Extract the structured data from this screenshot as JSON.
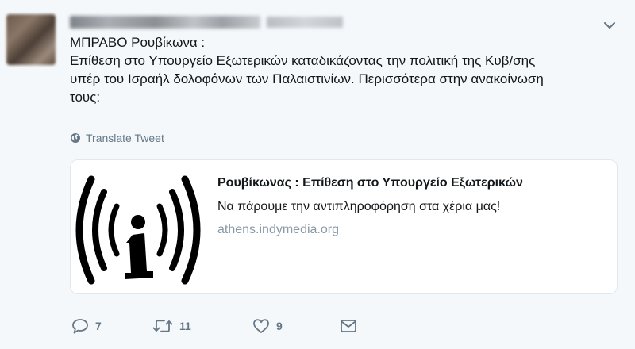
{
  "tweet": {
    "line1": "ΜΠΡΑΒΟ Ρουβίκωνα :",
    "line2": "Επίθεση στο Υπουργείο Εξωτερικών καταδικάζοντας την πολιτική της Κυβ/σης",
    "line3": "υπέρ του Ισραήλ δολοφόνων των Παλαιστινίων. Περισσότερα στην ανακοίνωση",
    "line4": "τους:"
  },
  "translate_label": "Translate Tweet",
  "card": {
    "title": "Ρουβίκωνας : Επίθεση στο Υπουργείο Εξωτερικών",
    "description": "Να πάρουμε την αντιπληροφόρηση στα χέρια μας!",
    "domain": "athens.indymedia.org"
  },
  "actions": {
    "replies": "7",
    "retweets": "11",
    "likes": "9"
  },
  "icons": {
    "reply": "speech-bubble-icon",
    "retweet": "retweet-arrows-icon",
    "like": "heart-icon",
    "dm": "envelope-icon",
    "caret": "chevron-down-icon",
    "globe": "globe-icon",
    "card_image": "indymedia-logo"
  },
  "colors": {
    "muted": "#657786",
    "url": "#8899a6",
    "text": "#14171a",
    "border": "#e1e8ed",
    "background": "#f5f8fa"
  }
}
